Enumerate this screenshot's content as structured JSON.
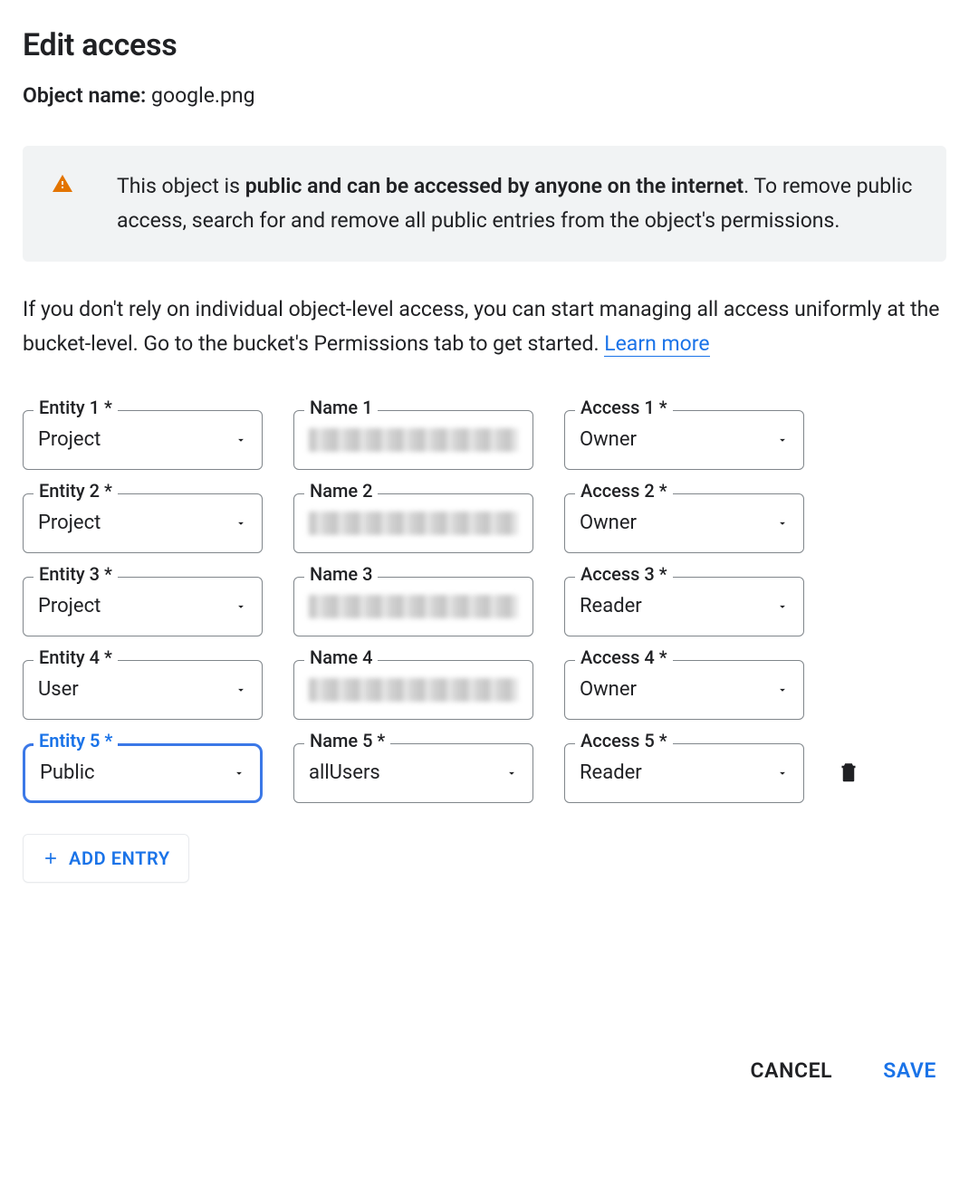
{
  "title": "Edit access",
  "object": {
    "label": "Object name:",
    "value": "google.png"
  },
  "alert": {
    "pre": "This object is ",
    "bold": "public and can be accessed by anyone on the internet",
    "post": ". To remove public access, search for and remove all public entries from the object's permissions."
  },
  "hint": {
    "text": "If you don't rely on individual object-level access, you can start managing all access uniformly at the bucket-level. Go to the bucket's Permissions tab to get started. ",
    "link": "Learn more"
  },
  "rows": [
    {
      "entity_label": "Entity 1 *",
      "entity_value": "Project",
      "name_label": "Name 1",
      "name_value": "",
      "name_redacted": true,
      "name_dropdown": false,
      "access_label": "Access 1 *",
      "access_value": "Owner",
      "highlight": false,
      "deletable": false
    },
    {
      "entity_label": "Entity 2 *",
      "entity_value": "Project",
      "name_label": "Name 2",
      "name_value": "",
      "name_redacted": true,
      "name_dropdown": false,
      "access_label": "Access 2 *",
      "access_value": "Owner",
      "highlight": false,
      "deletable": false
    },
    {
      "entity_label": "Entity 3 *",
      "entity_value": "Project",
      "name_label": "Name 3",
      "name_value": "",
      "name_redacted": true,
      "name_dropdown": false,
      "access_label": "Access 3 *",
      "access_value": "Reader",
      "highlight": false,
      "deletable": false
    },
    {
      "entity_label": "Entity 4 *",
      "entity_value": "User",
      "name_label": "Name 4",
      "name_value": "",
      "name_redacted": true,
      "name_dropdown": false,
      "access_label": "Access 4 *",
      "access_value": "Owner",
      "highlight": false,
      "deletable": false
    },
    {
      "entity_label": "Entity 5 *",
      "entity_value": "Public",
      "name_label": "Name 5 *",
      "name_value": "allUsers",
      "name_redacted": false,
      "name_dropdown": true,
      "access_label": "Access 5 *",
      "access_value": "Reader",
      "highlight": true,
      "deletable": true
    }
  ],
  "add_entry": "ADD ENTRY",
  "footer": {
    "cancel": "CANCEL",
    "save": "SAVE"
  }
}
